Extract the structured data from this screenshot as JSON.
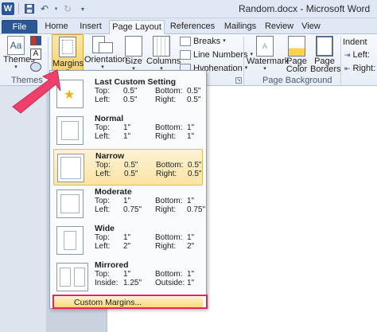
{
  "window": {
    "app_logo": "W",
    "title": "Random.docx - Microsoft Word"
  },
  "qat_icons": [
    "save-icon",
    "undo-icon",
    "redo-icon",
    "customize-icon"
  ],
  "tabs": [
    {
      "label": "File"
    },
    {
      "label": "Home"
    },
    {
      "label": "Insert"
    },
    {
      "label": "Page Layout"
    },
    {
      "label": "References"
    },
    {
      "label": "Mailings"
    },
    {
      "label": "Review"
    },
    {
      "label": "View"
    }
  ],
  "ribbon": {
    "themes_group_label": "Themes",
    "themes_label": "Themes",
    "margins_label": "Margins",
    "orientation_label": "Orientation",
    "size_label": "Size",
    "columns_label": "Columns",
    "breaks_label": "Breaks",
    "line_numbers_label": "Line Numbers",
    "hyphenation_label": "Hyphenation",
    "watermark_label": "Watermark",
    "page_color_label_1": "Page",
    "page_color_label_2": "Color",
    "page_borders_label_1": "Page",
    "page_borders_label_2": "Borders",
    "page_background_group_label": "Page Background",
    "indent_label": "Indent",
    "left_label": "Left:",
    "right_label": "Right:"
  },
  "margins_menu": {
    "items": [
      {
        "name": "Last Custom Setting",
        "k1": "Top:",
        "v1": "0.5\"",
        "k2": "Bottom:",
        "v2": "0.5\"",
        "k3": "Left:",
        "v3": "0.5\"",
        "k4": "Right:",
        "v4": "0.5\""
      },
      {
        "name": "Normal",
        "k1": "Top:",
        "v1": "1\"",
        "k2": "Bottom:",
        "v2": "1\"",
        "k3": "Left:",
        "v3": "1\"",
        "k4": "Right:",
        "v4": "1\""
      },
      {
        "name": "Narrow",
        "k1": "Top:",
        "v1": "0.5\"",
        "k2": "Bottom:",
        "v2": "0.5\"",
        "k3": "Left:",
        "v3": "0.5\"",
        "k4": "Right:",
        "v4": "0.5\""
      },
      {
        "name": "Moderate",
        "k1": "Top:",
        "v1": "1\"",
        "k2": "Bottom:",
        "v2": "1\"",
        "k3": "Left:",
        "v3": "0.75\"",
        "k4": "Right:",
        "v4": "0.75\""
      },
      {
        "name": "Wide",
        "k1": "Top:",
        "v1": "1\"",
        "k2": "Bottom:",
        "v2": "1\"",
        "k3": "Left:",
        "v3": "2\"",
        "k4": "Right:",
        "v4": "2\""
      },
      {
        "name": "Mirrored",
        "k1": "Top:",
        "v1": "1\"",
        "k2": "Bottom:",
        "v2": "1\"",
        "k3": "Inside:",
        "v3": "1.25\"",
        "k4": "Outside:",
        "v4": "1\""
      }
    ],
    "selected": "Narrow",
    "custom_label": "Custom Margins..."
  },
  "colors": {
    "file_tab": "#2b5797",
    "highlight_box": "#e6245e",
    "arrow": "#ef3f6b",
    "selected_item": "#fbe3a3"
  }
}
